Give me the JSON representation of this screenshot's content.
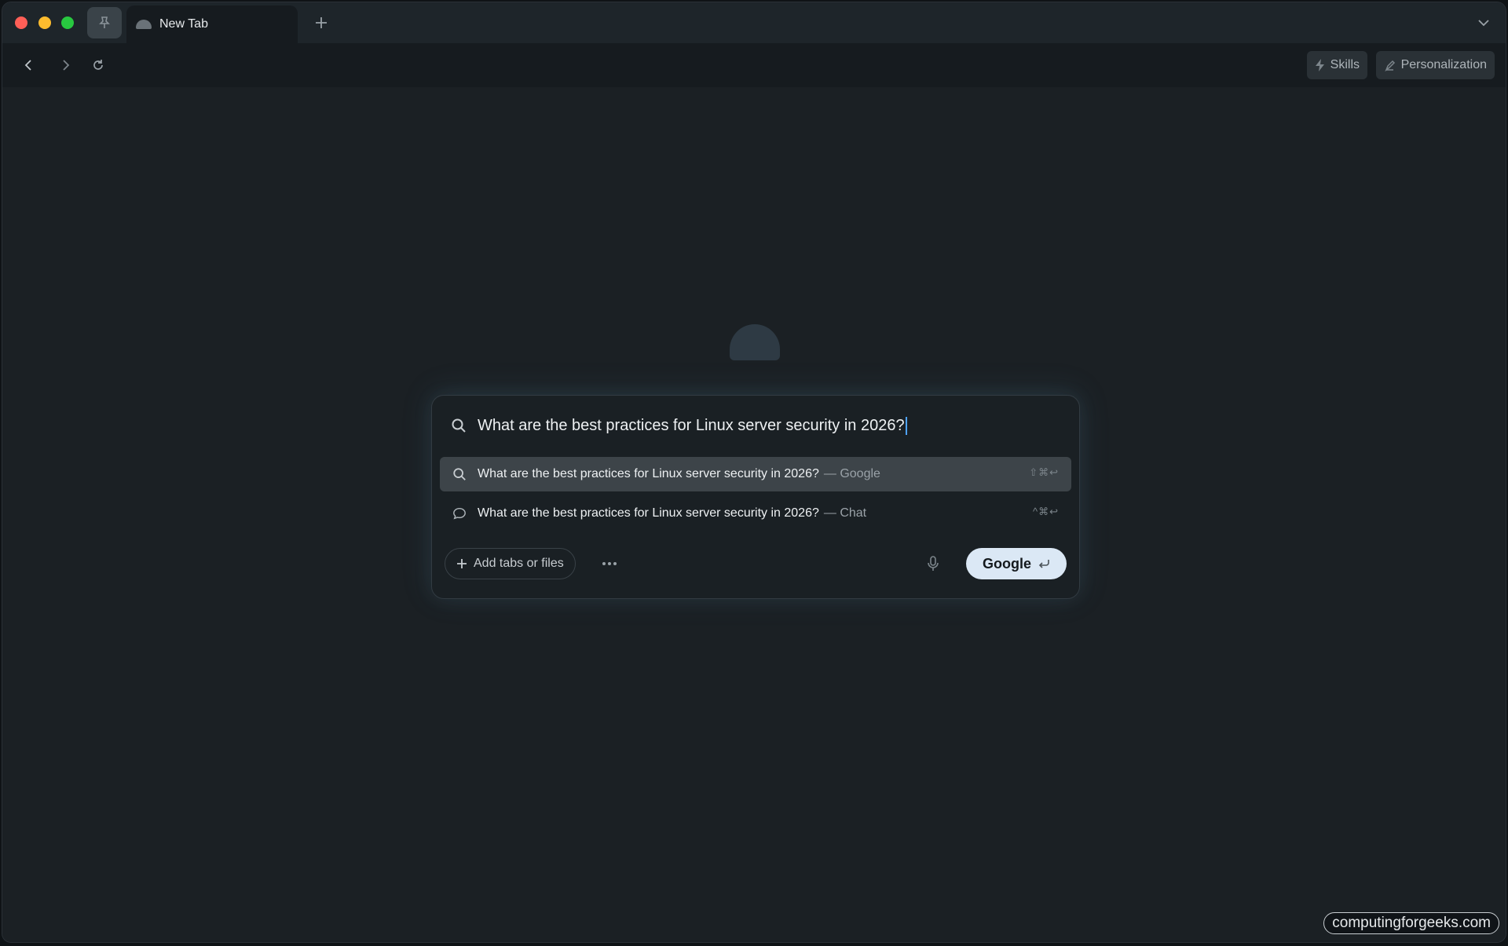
{
  "window": {
    "tab_title": "New Tab"
  },
  "toolbar": {
    "skills_label": "Skills",
    "personalization_label": "Personalization"
  },
  "search": {
    "query": "What are the best practices for Linux server security in 2026?",
    "suggestions": [
      {
        "text": "What are the best practices for Linux server security in 2026?",
        "source": "— Google",
        "shortcut": "⇧⌘↩",
        "icon": "search-icon"
      },
      {
        "text": "What are the best practices for Linux server security in 2026?",
        "source": "— Chat",
        "shortcut": "^⌘↩",
        "icon": "chat-bubble-icon"
      }
    ],
    "add_label": "Add tabs or files",
    "go_label": "Google"
  },
  "watermark": "computingforgeeks.com",
  "colors": {
    "accent_button": "#dbe8f5",
    "background": "#1b2024",
    "highlight_row": "#3d4449"
  }
}
